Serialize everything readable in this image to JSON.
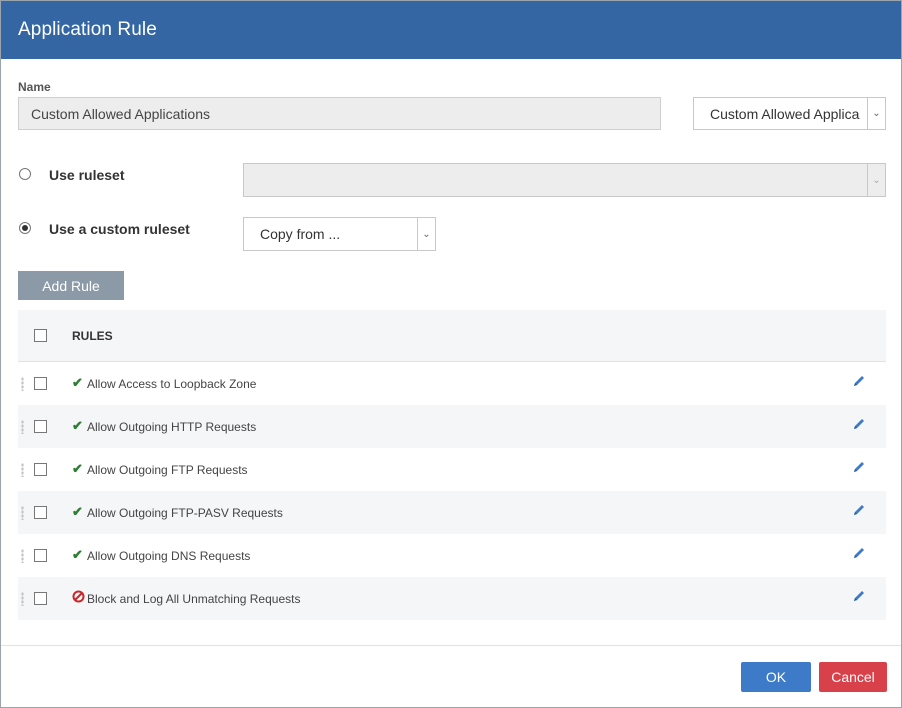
{
  "dialog": {
    "title": "Application Rule"
  },
  "name_field": {
    "label": "Name",
    "value": "Custom Allowed Applications"
  },
  "name_select": {
    "value": "Custom Allowed Applica"
  },
  "ruleset": {
    "use_ruleset_label": "Use ruleset",
    "use_ruleset_selected": false,
    "ruleset_select_value": "",
    "use_custom_label": "Use a custom ruleset",
    "use_custom_selected": true,
    "copy_from_value": "Copy from ..."
  },
  "add_rule_label": "Add Rule",
  "table": {
    "header": "RULES",
    "rows": [
      {
        "status": "allow",
        "label": "Allow Access to Loopback Zone"
      },
      {
        "status": "allow",
        "label": "Allow Outgoing HTTP Requests"
      },
      {
        "status": "allow",
        "label": "Allow Outgoing FTP Requests"
      },
      {
        "status": "allow",
        "label": "Allow Outgoing FTP-PASV Requests"
      },
      {
        "status": "allow",
        "label": "Allow Outgoing DNS Requests"
      },
      {
        "status": "block",
        "label": "Block and Log All Unmatching Requests"
      }
    ]
  },
  "footer": {
    "ok_label": "OK",
    "cancel_label": "Cancel"
  },
  "colors": {
    "header": "#3366a3",
    "ok": "#3d7bc8",
    "cancel": "#d9414a",
    "allow": "#2e7d32",
    "block": "#c62828"
  }
}
